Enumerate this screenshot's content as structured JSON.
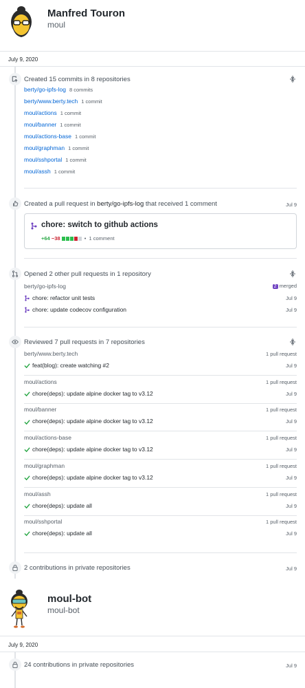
{
  "profile1": {
    "name": "Manfred Touron",
    "login": "moul"
  },
  "date1": "July 9, 2020",
  "commits": {
    "title": "Created 15 commits in 8 repositories",
    "repos": [
      {
        "name": "berty/go-ipfs-log",
        "count": "8 commits"
      },
      {
        "name": "berty/www.berty.tech",
        "count": "1 commit"
      },
      {
        "name": "moul/actions",
        "count": "1 commit"
      },
      {
        "name": "moul/banner",
        "count": "1 commit"
      },
      {
        "name": "moul/actions-base",
        "count": "1 commit"
      },
      {
        "name": "moul/graphman",
        "count": "1 commit"
      },
      {
        "name": "moul/sshportal",
        "count": "1 commit"
      },
      {
        "name": "moul/assh",
        "count": "1 commit"
      }
    ]
  },
  "created_pr": {
    "prefix": "Created a pull request in",
    "repo": "berty/go-ipfs-log",
    "suffix": "that received 1 comment",
    "date": "Jul 9",
    "card_title": "chore: switch to github actions",
    "additions": "+64",
    "deletions": "−38",
    "comments": "1 comment"
  },
  "opened": {
    "title": "Opened 2 other pull requests in 1 repository",
    "repo": "berty/go-ipfs-log",
    "badge_count": "2",
    "badge_label": "merged",
    "items": [
      {
        "title": "chore: refactor unit tests",
        "date": "Jul 9"
      },
      {
        "title": "chore: update codecov configuration",
        "date": "Jul 9"
      }
    ]
  },
  "reviewed": {
    "title": "Reviewed 7 pull requests in 7 repositories",
    "groups": [
      {
        "repo": "berty/www.berty.tech",
        "meta": "1 pull request",
        "title": "feat(blog): create watching #2",
        "date": "Jul 9"
      },
      {
        "repo": "moul/actions",
        "meta": "1 pull request",
        "title": "chore(deps): update alpine docker tag to v3.12",
        "date": "Jul 9"
      },
      {
        "repo": "moul/banner",
        "meta": "1 pull request",
        "title": "chore(deps): update alpine docker tag to v3.12",
        "date": "Jul 9"
      },
      {
        "repo": "moul/actions-base",
        "meta": "1 pull request",
        "title": "chore(deps): update alpine docker tag to v3.12",
        "date": "Jul 9"
      },
      {
        "repo": "moul/graphman",
        "meta": "1 pull request",
        "title": "chore(deps): update alpine docker tag to v3.12",
        "date": "Jul 9"
      },
      {
        "repo": "moul/assh",
        "meta": "1 pull request",
        "title": "chore(deps): update all",
        "date": "Jul 9"
      },
      {
        "repo": "moul/sshportal",
        "meta": "1 pull request",
        "title": "chore(deps): update all",
        "date": "Jul 9"
      }
    ]
  },
  "private1": {
    "title": "2 contributions in private repositories",
    "date": "Jul 9"
  },
  "profile2": {
    "name": "moul-bot",
    "login": "moul-bot"
  },
  "date2": "July 9, 2020",
  "private2": {
    "title": "24 contributions in private repositories",
    "date": "Jul 9"
  },
  "colors": {
    "link": "#0366d6",
    "green": "#28a745",
    "red": "#cb2431",
    "purple": "#6f42c1"
  }
}
